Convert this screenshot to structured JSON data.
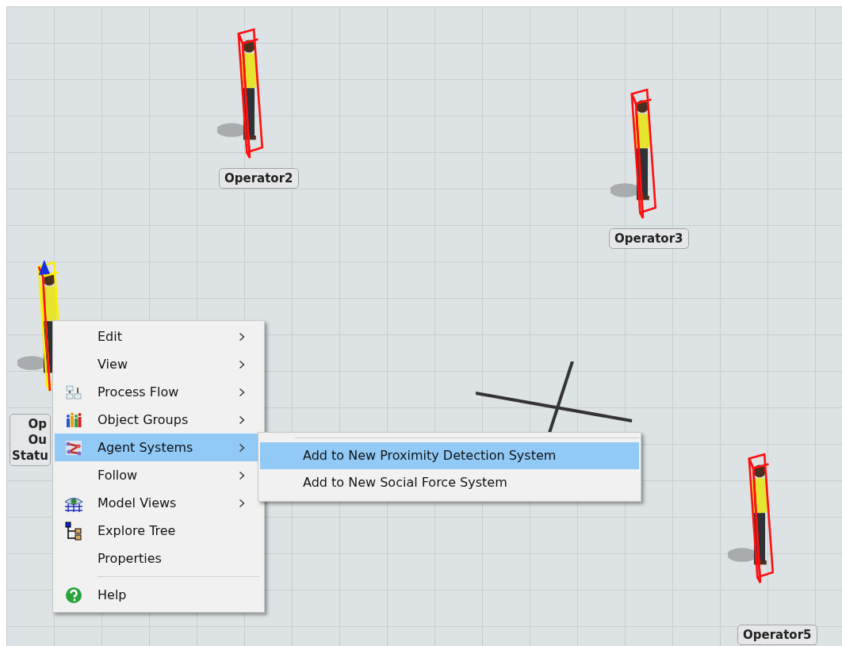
{
  "operators": [
    {
      "label": "Op\nOu\nStatu",
      "selected": true
    },
    {
      "label": "Operator2",
      "selected": false
    },
    {
      "label": "Operator3",
      "selected": false
    },
    {
      "label": "Operator5",
      "selected": false
    }
  ],
  "context_menu": {
    "items": [
      {
        "kind": "item",
        "label": "Edit",
        "submenu": true,
        "selected": false
      },
      {
        "kind": "item",
        "label": "View",
        "submenu": true,
        "selected": false
      },
      {
        "kind": "item",
        "label": "Process Flow",
        "submenu": true,
        "selected": false
      },
      {
        "kind": "item",
        "label": "Object Groups",
        "submenu": true,
        "selected": false
      },
      {
        "kind": "item",
        "label": "Agent Systems",
        "submenu": true,
        "selected": true
      },
      {
        "kind": "item",
        "label": "Follow",
        "submenu": true,
        "selected": false
      },
      {
        "kind": "item",
        "label": "Model Views",
        "submenu": true,
        "selected": false
      },
      {
        "kind": "item",
        "label": "Explore Tree",
        "submenu": false,
        "selected": false
      },
      {
        "kind": "item",
        "label": "Properties",
        "submenu": false,
        "selected": false
      },
      {
        "kind": "separator"
      },
      {
        "kind": "item",
        "label": "Help",
        "submenu": false,
        "selected": false
      }
    ]
  },
  "submenu": {
    "items": [
      {
        "label": "Add to New Proximity Detection System",
        "selected": true
      },
      {
        "label": "Add to New Social Force System",
        "selected": false
      }
    ]
  }
}
